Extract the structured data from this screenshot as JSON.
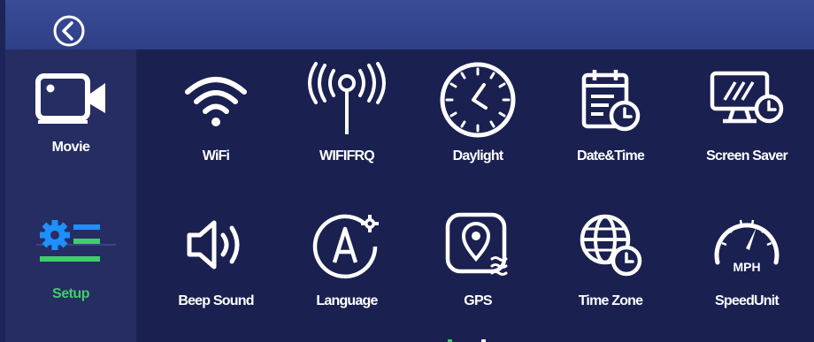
{
  "colors": {
    "accent_active": "#3fcf6a",
    "sidebar_active_icon": "#1e90ff",
    "text": "#ffffff"
  },
  "topbar": {
    "back_icon": "back-circle-icon"
  },
  "sidebar": {
    "items": [
      {
        "label": "Movie",
        "icon": "video-camera-icon",
        "active": false
      },
      {
        "label": "Setup",
        "icon": "settings-list-icon",
        "active": true
      }
    ]
  },
  "grid": {
    "rows": [
      [
        {
          "label": "WiFi",
          "icon": "wifi-icon"
        },
        {
          "label": "WIFIFRQ",
          "icon": "antenna-icon"
        },
        {
          "label": "Daylight",
          "icon": "clock-icon"
        },
        {
          "label": "Date&Time",
          "icon": "calendar-clock-icon"
        },
        {
          "label": "Screen Saver",
          "icon": "monitor-clock-icon"
        }
      ],
      [
        {
          "label": "Beep Sound",
          "icon": "speaker-icon"
        },
        {
          "label": "Language",
          "icon": "language-icon"
        },
        {
          "label": "GPS",
          "icon": "gps-pin-icon"
        },
        {
          "label": "Time Zone",
          "icon": "globe-clock-icon"
        },
        {
          "label": "SpeedUnit",
          "icon": "speedometer-icon"
        }
      ]
    ],
    "speed_unit_text": "MPH"
  }
}
